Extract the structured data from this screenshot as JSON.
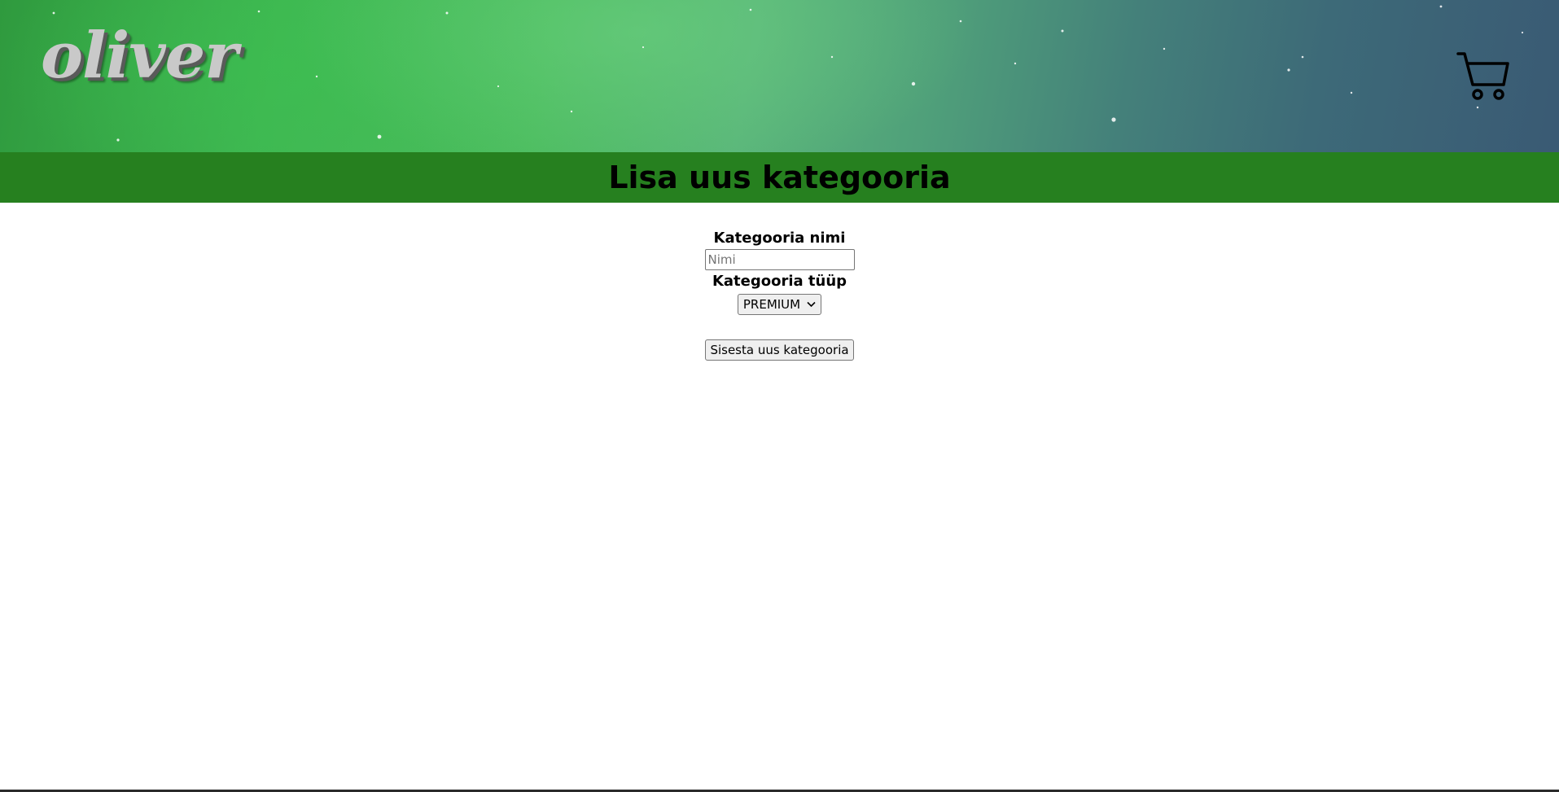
{
  "header": {
    "logo_text": "oliver",
    "cart_icon": "shopping-cart-icon"
  },
  "page": {
    "title": "Lisa uus kategooria"
  },
  "form": {
    "name_label": "Kategooria nimi",
    "name_placeholder": "Nimi",
    "name_value": "",
    "type_label": "Kategooria tüüp",
    "type_selected": "PREMIUM",
    "submit_label": "Sisesta uus kategooria"
  },
  "colors": {
    "title_bar": "#26801f",
    "header_green": "#3fb852",
    "header_blue": "#3a5a74"
  }
}
